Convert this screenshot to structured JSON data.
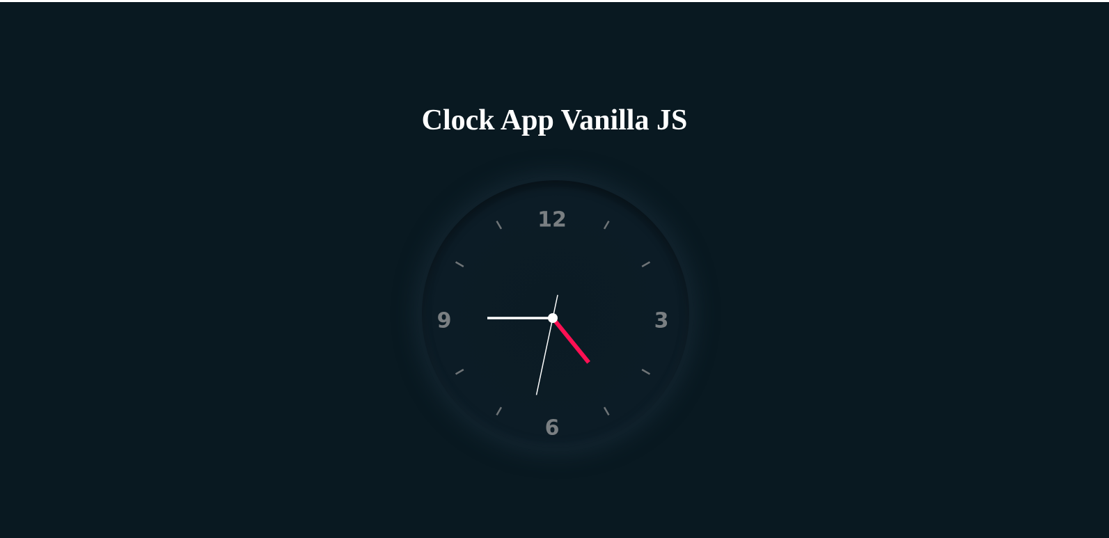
{
  "page": {
    "title": "Clock App Vanilla JS"
  },
  "clock": {
    "numbers": [
      "12",
      "3",
      "6",
      "9"
    ],
    "time": {
      "hours": 4,
      "minutes": 45,
      "seconds": 32
    },
    "colors": {
      "background": "#091921",
      "hour_hand": "#ff1053",
      "minute_hand": "#ffffff",
      "second_hand": "#ffffff",
      "numbers": "#7a7f82"
    }
  }
}
